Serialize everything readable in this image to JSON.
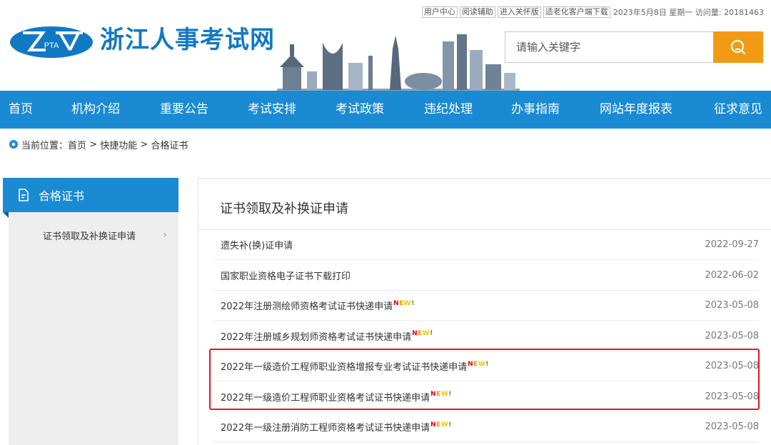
{
  "top_links": [
    "用户中心",
    "阅读辅助",
    "进入关怀版",
    "适老化客户端下载"
  ],
  "top_info": "2023年5月8日 星期一 访问量: 20181463",
  "header": {
    "logo_text": "PTA",
    "site_title": "浙江人事考试网",
    "search_placeholder": "请输入关键字"
  },
  "nav": [
    "首页",
    "机构介绍",
    "重要公告",
    "考试安排",
    "考试政策",
    "违纪处理",
    "办事指南",
    "网站年度报表",
    "征求意见"
  ],
  "breadcrumb": {
    "label": "当前位置：",
    "home": "首页",
    "sep1": " > ",
    "section": "快捷功能",
    "sep2": " > ",
    "current": "合格证书"
  },
  "sidebar": {
    "title": "合格证书",
    "items": [
      {
        "label": "证书领取及补换证申请",
        "arrow": "›"
      }
    ]
  },
  "main": {
    "title": "证书领取及补换证申请",
    "rows": [
      {
        "title": "遗失补(换)证申请",
        "date": "2022-09-27",
        "new": false
      },
      {
        "title": "国家职业资格电子证书下载打印",
        "date": "2022-06-02",
        "new": false
      },
      {
        "title": "2022年注册测绘师资格考试证书快递申请",
        "date": "2023-05-08",
        "new": true
      },
      {
        "title": "2022年注册城乡规划师资格考试证书快递申请",
        "date": "2023-05-08",
        "new": true
      },
      {
        "title": "2022年一级造价工程师职业资格增报专业考试证书快递申请",
        "date": "2023-05-08",
        "new": true
      },
      {
        "title": "2022年一级造价工程师职业资格考试证书快递申请",
        "date": "2023-05-08",
        "new": true
      },
      {
        "title": "2022年一级注册消防工程师资格考试证书快递申请",
        "date": "2023-05-08",
        "new": true
      }
    ],
    "new_badge": {
      "n": "N",
      "e": "E",
      "w": "W",
      "ex": "!"
    }
  },
  "colors": {
    "brand_blue": "#1a8ad3",
    "search_orange": "#f39a14",
    "highlight_red": "#e0191f"
  }
}
